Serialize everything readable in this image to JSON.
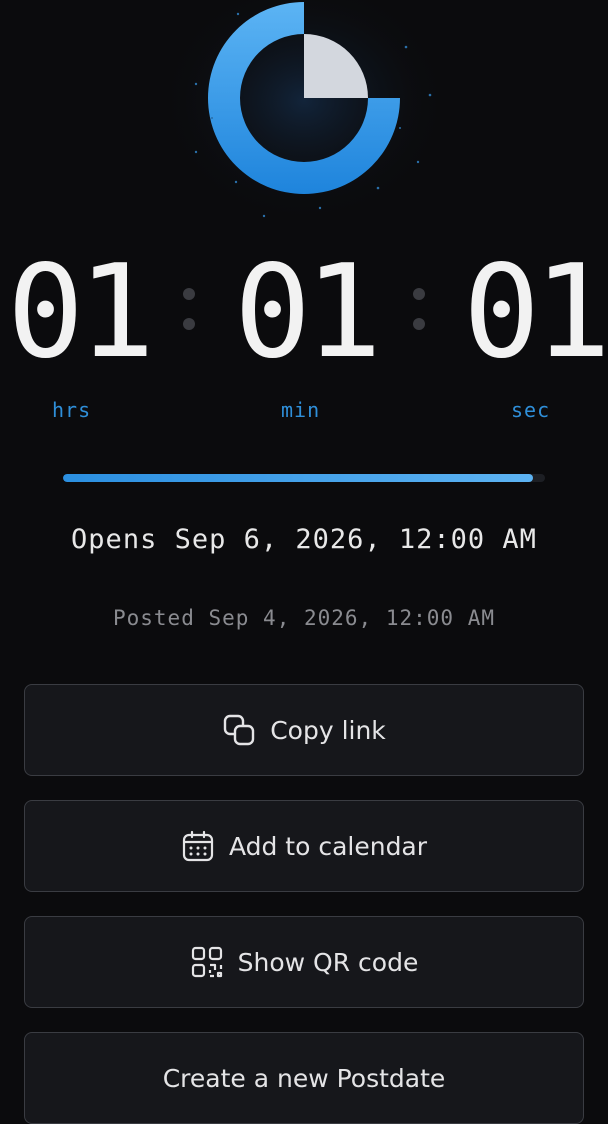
{
  "logo": {
    "icon": "clock-logo-icon",
    "colors": {
      "ring": "#2b8fe0",
      "wedge": "#d3d7de",
      "glow": "#12243a"
    }
  },
  "countdown": {
    "hours": "01",
    "minutes": "01",
    "seconds": "01",
    "unit_hours": "hrs",
    "unit_minutes": "min",
    "unit_seconds": "sec"
  },
  "progress": {
    "fraction": 0.975
  },
  "opens_text": "Opens Sep 6, 2026, 12:00 AM",
  "posted_text": "Posted Sep 4, 2026, 12:00 AM",
  "actions": {
    "copy_label": "Copy link",
    "calendar_label": "Add to calendar",
    "qr_label": "Show QR code",
    "new_label": "Create a new Postdate"
  },
  "colors": {
    "accent": "#2f8fd9",
    "background": "#0b0b0d",
    "button_bg": "#16171b",
    "button_border": "#3a3c42"
  }
}
